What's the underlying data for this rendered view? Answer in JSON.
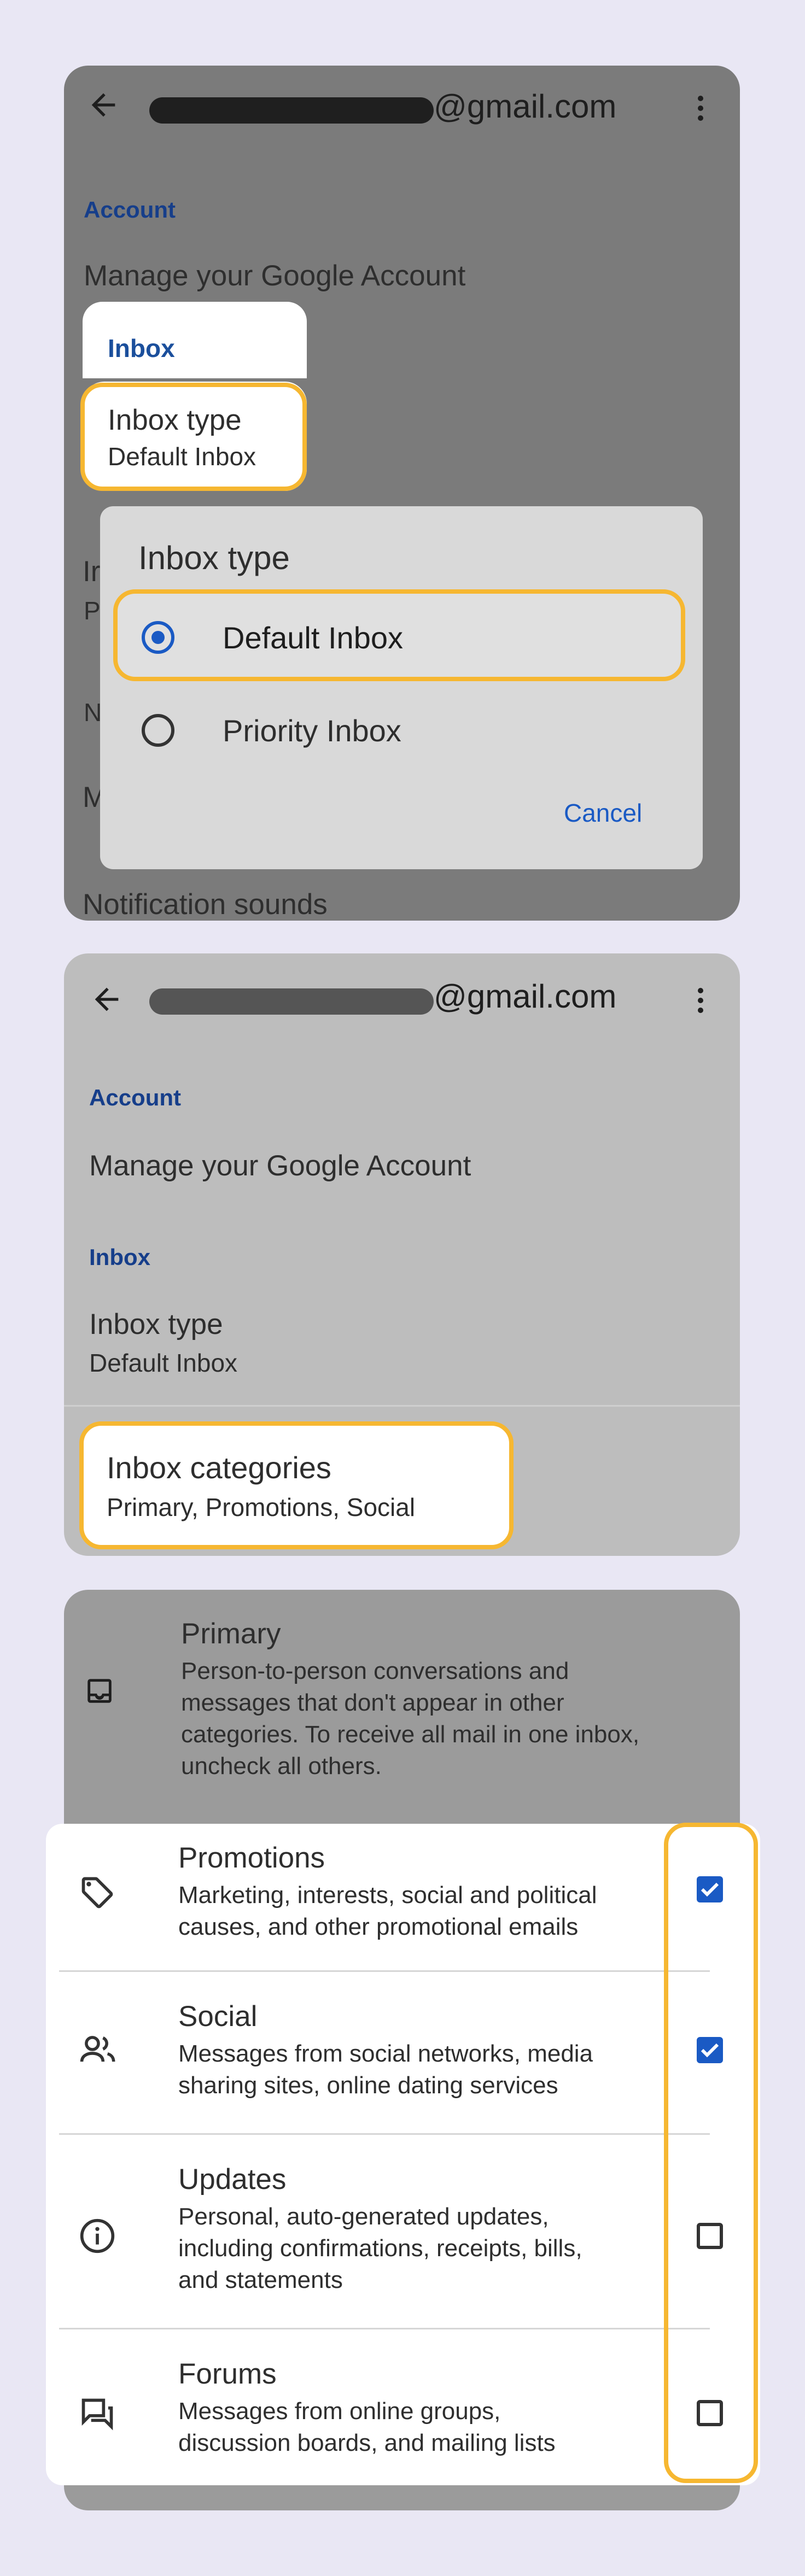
{
  "panel1": {
    "email_suffix": "@gmail.com",
    "account_header": "Account",
    "manage_account": "Manage your Google Account",
    "inbox_header": "Inbox",
    "inbox_type_title": "Inbox type",
    "inbox_type_value": "Default Inbox",
    "bg_fragment_1": "Ir",
    "bg_fragment_2": "P",
    "bg_fragment_3": "N",
    "bg_fragment_4": "M",
    "notification_sounds": "Notification sounds",
    "dialog": {
      "title": "Inbox type",
      "options": [
        "Default Inbox",
        "Priority Inbox"
      ],
      "selected": "Default Inbox",
      "cancel": "Cancel"
    }
  },
  "panel2": {
    "email_suffix": "@gmail.com",
    "account_header": "Account",
    "manage_account": "Manage your Google Account",
    "inbox_header": "Inbox",
    "inbox_type_title": "Inbox type",
    "inbox_type_value": "Default Inbox",
    "categories_title": "Inbox categories",
    "categories_value": "Primary, Promotions, Social"
  },
  "panel3": {
    "categories": [
      {
        "title": "Primary",
        "desc": [
          "Person-to-person conversations and",
          "messages that don't appear in other",
          "categories. To receive all mail in one inbox,",
          "uncheck all others."
        ],
        "icon": "inbox-tray-icon"
      },
      {
        "title": "Promotions",
        "desc": [
          "Marketing, interests, social and political",
          "causes, and other promotional emails"
        ],
        "icon": "tag-icon",
        "checked": true
      },
      {
        "title": "Social",
        "desc": [
          "Messages from social networks, media",
          "sharing sites, online dating services"
        ],
        "icon": "people-icon",
        "checked": true
      },
      {
        "title": "Updates",
        "desc": [
          "Personal, auto-generated updates,",
          "including confirmations, receipts, bills,",
          "and statements"
        ],
        "icon": "info-icon",
        "checked": false
      },
      {
        "title": "Forums",
        "desc": [
          "Messages from online groups,",
          "discussion boards, and mailing lists"
        ],
        "icon": "forum-icon",
        "checked": false
      }
    ]
  },
  "colors": {
    "highlight": "#f6b731",
    "accent": "#1a5ac4",
    "section_header": "#163e8a"
  }
}
